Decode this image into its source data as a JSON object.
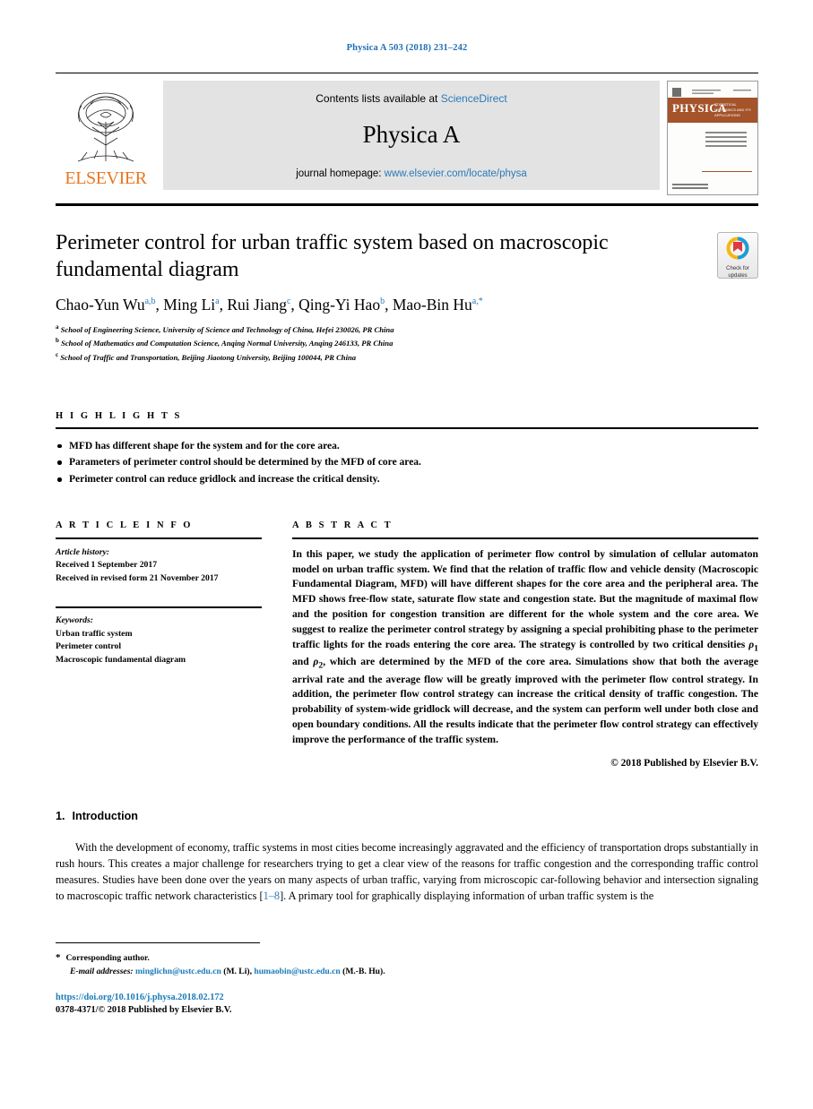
{
  "running_head": "Physica A 503 (2018) 231–242",
  "masthead": {
    "publisher_name": "ELSEVIER",
    "contents_prefix": "Contents lists available at",
    "contents_link": "ScienceDirect",
    "journal_name": "Physica A",
    "homepage_prefix": "journal homepage:",
    "homepage_url": "www.elsevier.com/locate/physa",
    "cover_title": "PHYSICA",
    "cover_subtitle": "STATISTICAL MECHANICS AND ITS APPLICATIONS"
  },
  "article": {
    "title": "Perimeter control for urban traffic system based on macroscopic fundamental diagram",
    "authors_html": "Chao-Yun Wu, Ming Li, Rui Jiang, Qing-Yi Hao, Mao-Bin Hu",
    "authors": [
      {
        "name": "Chao-Yun Wu",
        "marks": "a,b"
      },
      {
        "name": "Ming Li",
        "marks": "a"
      },
      {
        "name": "Rui Jiang",
        "marks": "c"
      },
      {
        "name": "Qing-Yi Hao",
        "marks": "b"
      },
      {
        "name": "Mao-Bin Hu",
        "marks": "a,*"
      }
    ],
    "affiliations": [
      {
        "mark": "a",
        "text": "School of Engineering Science, University of Science and Technology of China, Hefei 230026, PR China"
      },
      {
        "mark": "b",
        "text": "School of Mathematics and Computation Science, Anqing Normal University, Anqing 246133, PR China"
      },
      {
        "mark": "c",
        "text": "School of Traffic and Transportation, Beijing Jiaotong University, Beijing 100044, PR China"
      }
    ]
  },
  "crossmark": {
    "line1": "Check for",
    "line2": "updates"
  },
  "highlights": {
    "label": "H I G H L I G H T S",
    "items": [
      "MFD has different shape for the system and for the core area.",
      "Parameters of perimeter control should be determined by the MFD of core area.",
      "Perimeter control can reduce gridlock and increase the critical density."
    ]
  },
  "article_info": {
    "label": "A R T I C L E   I N F O",
    "history_label": "Article history:",
    "history": [
      "Received 1 September 2017",
      "Received in revised form 21 November 2017"
    ],
    "keywords_label": "Keywords:",
    "keywords": [
      "Urban traffic system",
      "Perimeter control",
      "Macroscopic fundamental diagram"
    ]
  },
  "abstract": {
    "label": "A B S T R A C T",
    "part1": "In this paper, we study the application of perimeter flow control by simulation of cellular automaton model on urban traffic system. We find that the relation of traffic flow and vehicle density (Macroscopic Fundamental Diagram, MFD) will have different shapes for the core area and the peripheral area. The MFD shows free-flow state, saturate flow state and congestion state. But the magnitude of maximal flow and the position for congestion transition are different for the whole system and the core area. We suggest to realize the perimeter control strategy by assigning a special prohibiting phase to the perimeter traffic lights for the roads entering the core area. The strategy is controlled by two critical densities ",
    "rho1": "ρ",
    "rho1_sub": "1",
    "mid": " and ",
    "rho2": "ρ",
    "rho2_sub": "2",
    "part2": ", which are determined by the MFD of the core area. Simulations show that both the average arrival rate and the average flow will be greatly improved with the perimeter flow control strategy. In addition, the perimeter flow control strategy can increase the critical density of traffic congestion. The probability of system-wide gridlock will decrease, and the system can perform well under both close and open boundary conditions. All the results indicate that the perimeter flow control strategy can effectively improve the performance of the traffic system.",
    "copyright": "© 2018 Published by Elsevier B.V."
  },
  "introduction": {
    "number": "1.",
    "title": "Introduction",
    "para_a": "With the development of economy, traffic systems in most cities become increasingly aggravated and the efficiency of transportation drops substantially in rush hours. This creates a major challenge for researchers trying to get a clear view of the reasons for traffic congestion and the corresponding traffic control measures. Studies have been done over the years on many aspects of urban traffic, varying from microscopic car-following behavior and intersection signaling to macroscopic traffic network characteristics [",
    "citation": "1–8",
    "para_b": "]. A primary tool for graphically displaying information of urban traffic system is the"
  },
  "footnotes": {
    "corresponding": "Corresponding author.",
    "email_label": "E-mail addresses:",
    "email1": "minglichn@ustc.edu.cn",
    "email1_owner": "(M. Li),",
    "email2": "humaobin@ustc.edu.cn",
    "email2_owner": "(M.-B. Hu)."
  },
  "bottom": {
    "doi": "https://doi.org/10.1016/j.physa.2018.02.172",
    "issn": "0378-4371/© 2018 Published by Elsevier B.V."
  },
  "colors": {
    "link_blue": "#2a7ab9",
    "header_blue": "#1f6fb5",
    "elsevier_orange": "#e87722",
    "cover_band": "#a4532a"
  }
}
